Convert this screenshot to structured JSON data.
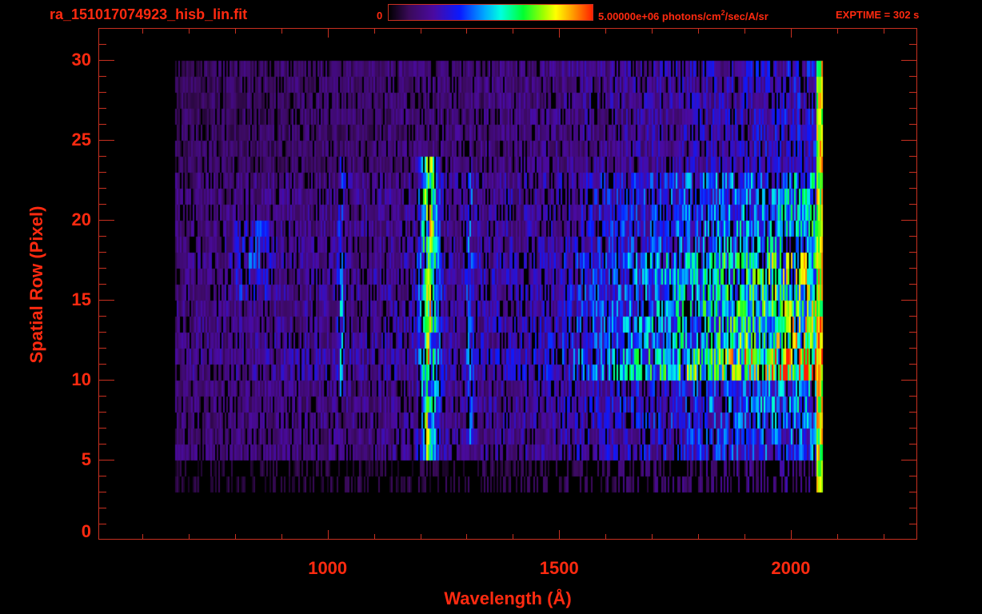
{
  "header": {
    "title": "ra_151017074923_hisb_lin.fit",
    "colorbar_min": "0",
    "colorbar_max_prefix": "5.00000e+06 photons/cm",
    "colorbar_max_sup": "2",
    "colorbar_max_suffix": "/sec/A/sr",
    "exptime": "EXPTIME = 302 s"
  },
  "colors": {
    "axis": "#c83020",
    "text": "#ff2a10",
    "background": "#000000"
  },
  "chart_data": {
    "type": "heatmap",
    "title": "ra_151017074923_hisb_lin.fit",
    "xlabel": "Wavelength (Å)",
    "ylabel": "Spatial Row (Pixel)",
    "xlim": [
      505,
      2273
    ],
    "ylim": [
      0,
      32
    ],
    "xticks": [
      1000,
      1500,
      2000
    ],
    "xtick_labels": [
      "1000",
      "1500",
      "2000"
    ],
    "yticks": [
      0,
      5,
      10,
      15,
      20,
      25,
      30
    ],
    "ytick_labels": [
      "0",
      "5",
      "10",
      "15",
      "20",
      "25",
      "30"
    ],
    "x_minor_step": 100,
    "y_minor_step": 1,
    "colorbar": {
      "min": 0,
      "max": 5000000,
      "units": "photons/cm^2/sec/A/sr",
      "colormap": "rainbow"
    },
    "data_extent": {
      "wavelength": [
        670,
        2065
      ],
      "rows": [
        3,
        29
      ]
    },
    "brightest_rows": [
      10,
      11
    ],
    "emission_features": [
      {
        "wavelength": 834,
        "rows": [
          15,
          19
        ],
        "relative_intensity": 0.15
      },
      {
        "wavelength": 1026,
        "rows": [
          9,
          23
        ],
        "relative_intensity": 0.22
      },
      {
        "wavelength": 1216,
        "rows": [
          5,
          23
        ],
        "relative_intensity": 0.5
      },
      {
        "wavelength": 1304,
        "rows": [
          6,
          23
        ],
        "relative_intensity": 0.18
      }
    ],
    "continuum": {
      "onset_wavelength": 1500,
      "peak_rows": [
        10,
        11
      ],
      "peak_relative_intensity": 0.9
    }
  }
}
